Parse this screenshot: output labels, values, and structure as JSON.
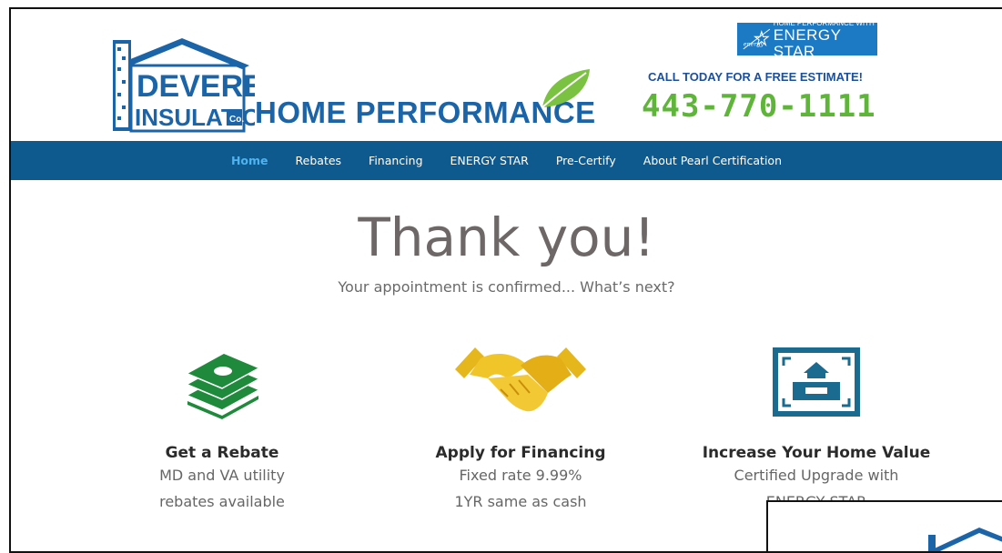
{
  "header": {
    "brand_line1": "DEVERE",
    "brand_line2": "INSULATION",
    "brand_co": "Co.",
    "brand_tagline": "HOME PERFORMANCE",
    "energy_star_small": "HOME PERFORMANCE WITH",
    "energy_star_big": "ENERGY STAR",
    "energy_logo_text": "energy",
    "call_text": "CALL TODAY FOR A FREE ESTIMATE!",
    "phone": "443-770-1111"
  },
  "nav": {
    "items": [
      {
        "label": "Home",
        "active": true
      },
      {
        "label": "Rebates"
      },
      {
        "label": "Financing"
      },
      {
        "label": "ENERGY STAR"
      },
      {
        "label": "Pre-Certify"
      },
      {
        "label": "About Pearl Certification"
      }
    ]
  },
  "hero": {
    "title": "Thank you!",
    "subtitle": "Your appointment is confirmed... What’s next?"
  },
  "features": [
    {
      "icon": "money-stack-icon",
      "heading": "Get a Rebate",
      "line1": "MD and VA utility",
      "line2": "rebates available"
    },
    {
      "icon": "handshake-icon",
      "heading": "Apply for Financing",
      "line1": "Fixed rate 9.99%",
      "line2": "1YR same as cash"
    },
    {
      "icon": "house-certificate-icon",
      "heading": "Increase Your Home Value",
      "line1": "Certified Upgrade with",
      "line2": "ENERGY STAR"
    }
  ],
  "colors": {
    "nav_bg": "#0e5a8e",
    "nav_active": "#4fb3f0",
    "brand_blue": "#1c64a8",
    "phone_green": "#5fb43a",
    "money_green": "#1f8a3b",
    "handshake_gold": "#e5b71d",
    "cert_blue": "#1b6b91"
  }
}
